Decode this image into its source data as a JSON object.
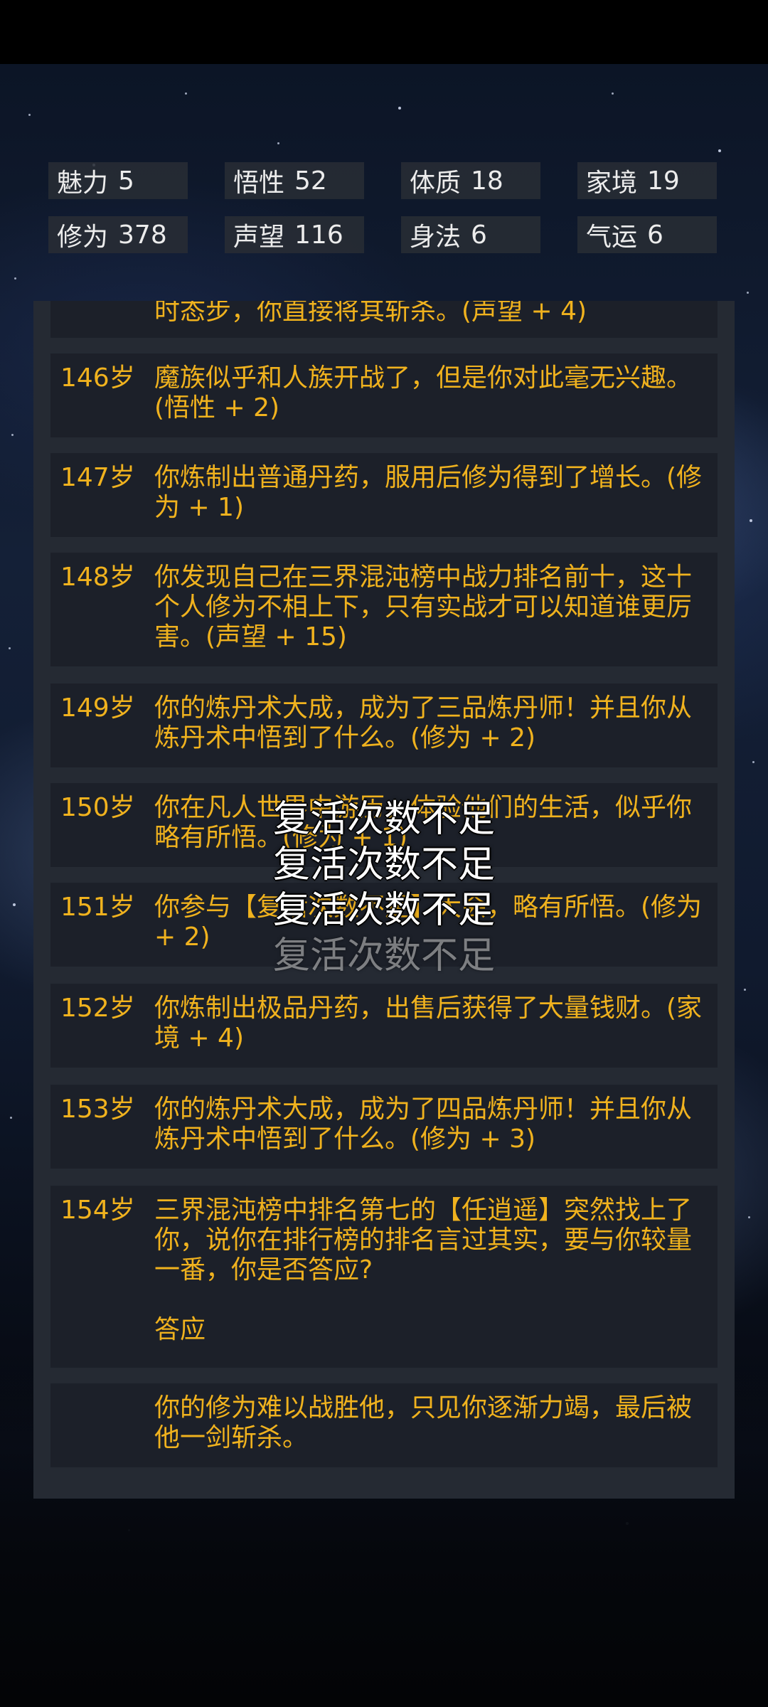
{
  "stats": [
    {
      "label": "魅力",
      "value": "5"
    },
    {
      "label": "悟性",
      "value": "52"
    },
    {
      "label": "体质",
      "value": "18"
    },
    {
      "label": "家境",
      "value": "19"
    },
    {
      "label": "修为",
      "value": "378"
    },
    {
      "label": "声望",
      "value": "116"
    },
    {
      "label": "身法",
      "value": "6"
    },
    {
      "label": "气运",
      "value": "6"
    }
  ],
  "log": {
    "partial_top": "时态步，你直接将其斩杀。(声望 + 4)",
    "entries": [
      {
        "age": "146岁",
        "text": "魔族似乎和人族开战了，但是你对此毫无兴趣。(悟性 + 2)"
      },
      {
        "age": "147岁",
        "text": "你炼制出普通丹药，服用后修为得到了增长。(修为 + 1)"
      },
      {
        "age": "148岁",
        "text": "你发现自己在三界混沌榜中战力排名前十，这十个人修为不相上下，只有实战才可以知道谁更厉害。(声望 + 15)"
      },
      {
        "age": "149岁",
        "text": "你的炼丹术大成，成为了三品炼丹师！并且你从炼丹术中悟到了什么。(修为 + 2)"
      },
      {
        "age": "150岁",
        "text": "你在凡人世界中游历，体验他们的生活，似乎你略有所悟。(修为 + 1)"
      },
      {
        "age": "151岁",
        "text": "你参与【复活次数不足】大会，略有所悟。(修为 + 2)"
      },
      {
        "age": "152岁",
        "text": "你炼制出极品丹药，出售后获得了大量钱财。(家境 + 4)"
      },
      {
        "age": "153岁",
        "text": "你的炼丹术大成，成为了四品炼丹师！并且你从炼丹术中悟到了什么。(修为 + 3)"
      },
      {
        "age": "154岁",
        "text": "三界混沌榜中排名第七的【任逍遥】突然找上了你，说你在排行榜的排名言过其实，要与你较量一番，你是否答应?",
        "choice": "答应"
      },
      {
        "age": "",
        "text": "你的修为难以战胜他，只见你逐渐力竭，最后被他一剑斩杀。"
      }
    ]
  },
  "toasts": [
    "复活次数不足",
    "复活次数不足",
    "复活次数不足",
    "复活次数不足"
  ]
}
